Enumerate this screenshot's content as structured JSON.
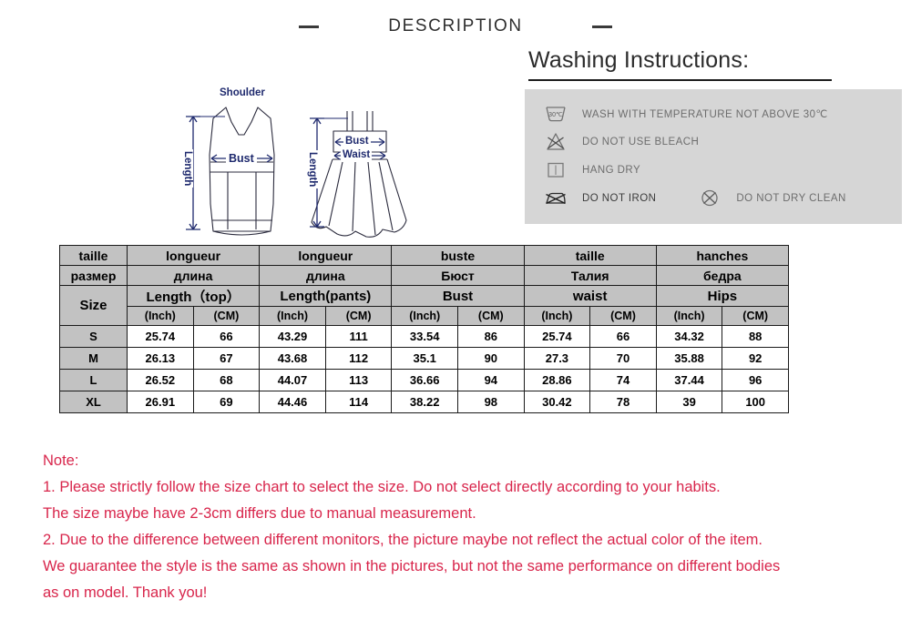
{
  "header": {
    "title": "DESCRIPTION",
    "left_dash": "dash",
    "right_dash": "dash"
  },
  "diagram": {
    "top_garment": {
      "shoulder_label": "Shoulder",
      "bust_label": "Bust",
      "length_label": "Length"
    },
    "bottom_garment": {
      "bust_label": "Bust",
      "waist_label": "Waist",
      "length_label": "Length"
    },
    "label_color": "#1f2a6e"
  },
  "washing": {
    "title": "Washing Instructions:",
    "panel_bg": "#d6d6d6",
    "items": [
      {
        "icon": "wash-temperature-icon",
        "label": "WASH WITH TEMPERATURE NOT ABOVE 30℃",
        "temp": "30℃"
      },
      {
        "icon": "no-bleach-icon",
        "label": "DO NOT USE BLEACH"
      },
      {
        "icon": "hang-dry-icon",
        "label": "HANG DRY"
      },
      {
        "icon": "no-iron-icon",
        "label": "DO NOT IRON"
      },
      {
        "icon": "no-dry-clean-icon",
        "label": "DO NOT DRY CLEAN"
      }
    ]
  },
  "size_table": {
    "header_bg": "#c2c2c2",
    "rows": {
      "french": [
        "taille",
        "longueur",
        "longueur",
        "buste",
        "taille",
        "hanches"
      ],
      "russian": [
        "размер",
        "длина",
        "длина",
        "Бюст",
        "Талия",
        "бедра"
      ],
      "english": [
        "Size",
        "Length（top）",
        "Length(pants)",
        "Bust",
        "waist",
        "Hips"
      ],
      "units": [
        "(Inch)",
        "(CM)",
        "(Inch)",
        "(CM)",
        "(Inch)",
        "(CM)",
        "(Inch)",
        "(CM)",
        "(Inch)",
        "(CM)"
      ]
    },
    "data": [
      {
        "size": "S",
        "values": [
          "25.74",
          "66",
          "43.29",
          "111",
          "33.54",
          "86",
          "25.74",
          "66",
          "34.32",
          "88"
        ]
      },
      {
        "size": "M",
        "values": [
          "26.13",
          "67",
          "43.68",
          "112",
          "35.1",
          "90",
          "27.3",
          "70",
          "35.88",
          "92"
        ]
      },
      {
        "size": "L",
        "values": [
          "26.52",
          "68",
          "44.07",
          "113",
          "36.66",
          "94",
          "28.86",
          "74",
          "37.44",
          "96"
        ]
      },
      {
        "size": "XL",
        "values": [
          "26.91",
          "69",
          "44.46",
          "114",
          "38.22",
          "98",
          "30.42",
          "78",
          "39",
          "100"
        ]
      }
    ]
  },
  "note": {
    "color": "#d8254b",
    "lines": [
      "Note:",
      "1. Please strictly follow the size chart to select the size. Do not select directly according to your habits.",
      "The size maybe have 2-3cm differs due to manual measurement.",
      "2. Due to the difference between different monitors, the picture maybe not reflect the actual color of the item.",
      "We guarantee the style is the same as shown in the pictures, but not the same performance on different bodies",
      "as on model. Thank you!"
    ]
  }
}
